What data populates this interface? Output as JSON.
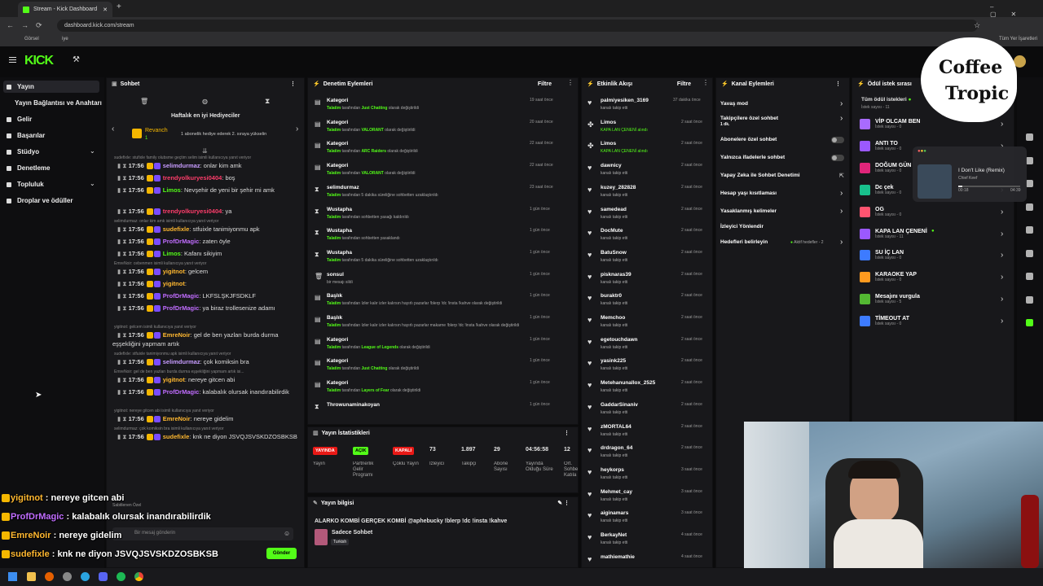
{
  "browser": {
    "tab_title": "Stream - Kick Dashboard",
    "url": "dashboard.kick.com/stream",
    "bookmarks": [
      "Görsel",
      "iye"
    ],
    "bookmarks_right": "Tüm Yer İşaretleri"
  },
  "nav": {
    "items": [
      "Yayın",
      "Yayın Bağlantısı ve Anahtarı",
      "Gelir",
      "Başarılar",
      "Stüdyo",
      "Denetleme",
      "Topluluk",
      "Droplar ve ödüller"
    ]
  },
  "chat": {
    "title": "Sohbet",
    "weekly": "Haftalık en iyi Hediyeciler",
    "top_name": "Revanch",
    "top_count": "1",
    "top_text": "1 abonelik hediye ederek 2. sıraya yükselin",
    "lines": [
      {
        "reply": "sudefixle: stufixle family olubsme geçtim selim isimli kullanıcıya yanıt veriyor",
        "user": "selimdurmaz",
        "color": "#c79cff",
        "text": "onlar kim amk",
        "time": "17:56"
      },
      {
        "user": "trendyolkuryesi0404",
        "color": "#ff3d6b",
        "text": "boş",
        "time": "17:56"
      },
      {
        "user": "Limos",
        "color": "#53fc18",
        "text": "Nevşehir de yeni bir şehir mi amk",
        "time": "17:56"
      },
      {
        "user": "trendyolkuryesi0404",
        "color": "#ff3d6b",
        "text": "ya",
        "time": "17:56"
      },
      {
        "reply": "selimdurmaz: onlar kim amk isimli kullanıcıya yanıt veriyor",
        "user": "sudefixle",
        "color": "#ffb830",
        "text": "stfuixle tanimiyonmu apk",
        "time": "17:56"
      },
      {
        "user": "ProfDrMagic",
        "color": "#c16dff",
        "text": "zaten öyle",
        "time": "17:56"
      },
      {
        "user": "Limos",
        "color": "#53fc18",
        "text": "Kafanı sikiyim",
        "time": "17:56"
      },
      {
        "reply": "EmreNoir: cebenmen isimli kullanıcıya yanıt veriyor",
        "user": "yigitnot",
        "color": "#ffb830",
        "text": "gelcem",
        "time": "17:56"
      },
      {
        "user": "yigitnot",
        "color": "#ffb830",
        "text": "",
        "time": "17:56"
      },
      {
        "user": "ProfDrMagic",
        "color": "#c16dff",
        "text": "LKFSLŞKJFSDKLF",
        "time": "17:56"
      },
      {
        "user": "ProfDrMagic",
        "color": "#c16dff",
        "text": "ya biraz trollesenize adamı",
        "time": "17:56"
      },
      {
        "reply": "yigitnot: gelcem isimli kullanıcıya yanıt veriyor",
        "user": "EmreNoir",
        "color": "#ffb830",
        "text": "gel de ben yazları burda durma eşşekliğini yapmam artık",
        "time": "17:56"
      },
      {
        "reply": "sudefixle: stfuixle tanimiyonmu apk isimli kullanıcıya yanıt veriyor",
        "user": "selimdurmaz",
        "color": "#c79cff",
        "text": "çok komiksin bra",
        "time": "17:56"
      },
      {
        "reply": "EmreNoir: gel de ben yazları burda durma eşşekliğini yapmam artık isi...",
        "user": "yigitnot",
        "color": "#ffb830",
        "text": "nereye gitcen abi",
        "time": "17:56"
      },
      {
        "user": "ProfDrMagic",
        "color": "#c16dff",
        "text": "kalabalık olursak inandırabilirdik",
        "time": "17:56"
      },
      {
        "reply": "yigitnot: nereye gitcen abi isimli kullanıcıya yanıt veriyor",
        "user": "EmreNoir",
        "color": "#ffb830",
        "text": "nereye gidelim",
        "time": "17:56"
      },
      {
        "reply": "selimdurmaz: çok komiksin bra isimli kullanıcıya yanıt veriyor",
        "user": "sudefixle",
        "color": "#ffb830",
        "text": "knk ne diyon JSVQJSVSKDZOSBKSB",
        "time": "17:56"
      }
    ],
    "input_placeholder": "Bir mesaj gönderin",
    "send": "Gönder",
    "pinned": "Sabitlenen Özel"
  },
  "overlay": [
    {
      "user": "yigitnot",
      "color": "#ffb830",
      "text": "nereye gitcen abi"
    },
    {
      "user": "ProfDrMagic",
      "color": "#c16dff",
      "text": "kalabalık olursak inandırabilirdik"
    },
    {
      "user": "EmreNoir",
      "color": "#ffb830",
      "text": "nereye gidelim"
    },
    {
      "user": "sudefixle",
      "color": "#ffb830",
      "text": "knk ne diyon JSVQJSVSKDZOSBKSB"
    }
  ],
  "moderation": {
    "title": "Denetim Eylemleri",
    "filter": "Filtre",
    "items": [
      {
        "title": "Kategori",
        "actor": "Talatim",
        "mid": " tarafından ",
        "target": "Just Chatting",
        "tail": " olarak değiştirildi",
        "time": "19 saat önce"
      },
      {
        "title": "Kategori",
        "actor": "Talatim",
        "mid": " tarafından ",
        "target": "VALORANT",
        "tail": " olarak değiştirildi",
        "time": "20 saat önce"
      },
      {
        "title": "Kategori",
        "actor": "Talatim",
        "mid": " tarafından ",
        "target": "ARC Raiders",
        "tail": " olarak değiştirildi",
        "time": "22 saat önce"
      },
      {
        "title": "Kategori",
        "actor": "Talatim",
        "mid": " tarafından ",
        "target": "VALORANT",
        "tail": " olarak değiştirildi",
        "time": "22 saat önce"
      },
      {
        "title": "selimdurmaz",
        "actor": "Talatim",
        "mid": " tarafından 5 dakika süreliğine sohbetten uzaklaştırıldı",
        "target": "",
        "tail": "",
        "time": "23 saat önce"
      },
      {
        "title": "Wustapha",
        "actor": "Talatim",
        "mid": " tarafından sohbetten yasağı kaldırıldı",
        "target": "",
        "tail": "",
        "time": "1 gün önce"
      },
      {
        "title": "Wustapha",
        "actor": "Talatim",
        "mid": " tarafından sohbetten yasaklandı",
        "target": "",
        "tail": "",
        "time": "1 gün önce"
      },
      {
        "title": "Wustapha",
        "actor": "Talatim",
        "mid": " tarafından 5 dakika süreliğine sohbetten uzaklaştırıldı",
        "target": "",
        "tail": "",
        "time": "1 gün önce"
      },
      {
        "title": "sonsul",
        "actor": "",
        "mid": "bir mesajı sildi",
        "target": "",
        "tail": "",
        "time": "1 gün önce"
      },
      {
        "title": "Başlık",
        "actor": "Talatim",
        "mid": " tarafından ",
        "target": "",
        "tail": "İzler kalır izler kalırsın hayırlı pazarlar !blerp !dc !insta !kahve olarak değiştirildi",
        "time": "1 gün önce"
      },
      {
        "title": "Başlık",
        "actor": "Talatim",
        "mid": " tarafından ",
        "target": "",
        "tail": "İzler kalır izler kalırsın hayırlı pazarlar makarne !blerp !dc !insta !kahve olarak değiştirildi",
        "time": "1 gün önce"
      },
      {
        "title": "Kategori",
        "actor": "Talatim",
        "mid": " tarafından ",
        "target": "League of Legends",
        "tail": " olarak değiştirildi",
        "time": "1 gün önce"
      },
      {
        "title": "Kategori",
        "actor": "Talatim",
        "mid": " tarafından ",
        "target": "Just Chatting",
        "tail": " olarak değiştirildi",
        "time": "1 gün önce"
      },
      {
        "title": "Kategori",
        "actor": "Talatim",
        "mid": " tarafından ",
        "target": "Layers of Fear",
        "tail": " olarak değiştirildi",
        "time": "1 gün önce"
      },
      {
        "title": "Throwunaminakoyan",
        "actor": "",
        "mid": "",
        "target": "",
        "tail": "",
        "time": "1 gün önce"
      }
    ]
  },
  "stats": {
    "title": "Yayın İstatistikleri",
    "cols": [
      {
        "value": "YAYINDA",
        "label": "Yayın",
        "color": "#e91916"
      },
      {
        "value": "AÇIK",
        "label": "Partnerlik Gelir Programı",
        "color": "#53fc18"
      },
      {
        "value": "KAPALI",
        "label": "Çoklu Yayın",
        "color": "#e91916"
      },
      {
        "value": "73",
        "label": "İzleyici"
      },
      {
        "value": "1.897",
        "label": "Takipçi"
      },
      {
        "value": "29",
        "label": "Abone Sayısı"
      },
      {
        "value": "04:56:58",
        "label": "Yayında Olduğu Süre"
      },
      {
        "value": "12",
        "label": "Ort. Sohbe Katıla"
      }
    ]
  },
  "info": {
    "title": "Yayın bilgisi",
    "stream_title": "ALARKO KOMBİ GERÇEK KOMBİ @aphebucky !blerp !dc !insta !kahve",
    "category": "Sadece Sohbet",
    "lang": "Turkish"
  },
  "activity": {
    "title": "Etkinlik Akışı",
    "filter": "Filtre",
    "items": [
      {
        "user": "palmiyesiken_3169",
        "sub": "kanalı takip etti",
        "time": "37 dakika önce",
        "kind": "follow"
      },
      {
        "user": "Limos",
        "sub": "KAPA LAN ÇENENİ alındı",
        "time": "2 saat önce",
        "kind": "reward"
      },
      {
        "user": "Limos",
        "sub": "KAPA LAN ÇENENİ alındı",
        "time": "2 saat önce",
        "kind": "reward"
      },
      {
        "user": "dawnicy",
        "sub": "kanalı takip etti",
        "time": "2 saat önce",
        "kind": "follow"
      },
      {
        "user": "kuzey_282828",
        "sub": "kanalı takip etti",
        "time": "2 saat önce",
        "kind": "follow"
      },
      {
        "user": "samedead",
        "sub": "kanalı takip etti",
        "time": "2 saat önce",
        "kind": "follow"
      },
      {
        "user": "DocMute",
        "sub": "kanalı takip etti",
        "time": "2 saat önce",
        "kind": "follow"
      },
      {
        "user": "BatuSnow",
        "sub": "kanalı takip etti",
        "time": "2 saat önce",
        "kind": "follow"
      },
      {
        "user": "pisknaras39",
        "sub": "kanalı takip etti",
        "time": "2 saat önce",
        "kind": "follow"
      },
      {
        "user": "buraktr0",
        "sub": "kanalı takip etti",
        "time": "2 saat önce",
        "kind": "follow"
      },
      {
        "user": "Memchoo",
        "sub": "kanalı takip etti",
        "time": "2 saat önce",
        "kind": "follow"
      },
      {
        "user": "egetouchdawn",
        "sub": "kanalı takip etti",
        "time": "2 saat önce",
        "kind": "follow"
      },
      {
        "user": "yasink225",
        "sub": "kanalı takip etti",
        "time": "2 saat önce",
        "kind": "follow"
      },
      {
        "user": "Metehanunallox_2525",
        "sub": "kanalı takip etti",
        "time": "2 saat önce",
        "kind": "follow"
      },
      {
        "user": "GaddarSinaniv",
        "sub": "kanalı takip etti",
        "time": "2 saat önce",
        "kind": "follow"
      },
      {
        "user": "zMORTAL64",
        "sub": "kanalı takip etti",
        "time": "2 saat önce",
        "kind": "follow"
      },
      {
        "user": "drdragon_64",
        "sub": "kanalı takip etti",
        "time": "2 saat önce",
        "kind": "follow"
      },
      {
        "user": "heykorps",
        "sub": "kanalı takip etti",
        "time": "3 saat önce",
        "kind": "follow"
      },
      {
        "user": "Mehmet_cay",
        "sub": "kanalı takip etti",
        "time": "3 saat önce",
        "kind": "follow"
      },
      {
        "user": "aiginamars",
        "sub": "kanalı takip etti",
        "time": "3 saat önce",
        "kind": "follow"
      },
      {
        "user": "BerkayNet",
        "sub": "kanalı takip etti",
        "time": "4 saat önce",
        "kind": "follow"
      },
      {
        "user": "mathiemathie",
        "sub": "",
        "time": "4 saat önce",
        "kind": "follow"
      }
    ]
  },
  "channel": {
    "title": "Kanal Eylemleri",
    "items": [
      {
        "label": "Yavaş mod",
        "sub": "",
        "ctl": "chev"
      },
      {
        "label": "Takipçilere özel sohbet",
        "sub": "1 dk.",
        "ctl": "chev"
      },
      {
        "label": "Abonelere özel sohbet",
        "sub": "",
        "ctl": "toggle"
      },
      {
        "label": "Yalnızca ifadelerle sohbet",
        "sub": "",
        "ctl": "toggle"
      },
      {
        "label": "Yapay Zeka ile Sohbet Denetimi",
        "sub": "",
        "ctl": "ext"
      },
      {
        "label": "Hesap yaşı kısıtlaması",
        "sub": "",
        "ctl": "chev"
      },
      {
        "label": "Yasaklanmış kelimeler",
        "sub": "",
        "ctl": "chev"
      },
      {
        "label": "İzleyici Yönlendir",
        "sub": "",
        "ctl": "none"
      },
      {
        "label": "Hedefleri belirleyin",
        "sub": "",
        "ctl": "goal"
      }
    ],
    "goal_text": "Aktif hedefler - 2"
  },
  "rewards": {
    "title": "Ödül istek sırası",
    "all": "Tüm ödül istekleri",
    "all_sub": "İstek sayısı - 11",
    "items": [
      {
        "name": "VİP OLCAM BEN",
        "sub": "İstek sayısı - 0",
        "color": "#a86bff",
        "active": false
      },
      {
        "name": "ANTI TO",
        "sub": "İstek sayısı - 0",
        "color": "#9b59ff",
        "active": false
      },
      {
        "name": "DOĞUM GÜN",
        "sub": "İstek sayısı - 0",
        "color": "#e0257a",
        "active": false
      },
      {
        "name": "Dc çek",
        "sub": "İstek sayısı - 0",
        "color": "#18c08c",
        "active": false
      },
      {
        "name": "OG",
        "sub": "İstek sayısı - 0",
        "color": "#ff5470",
        "active": false
      },
      {
        "name": "KAPA LAN ÇENENİ",
        "sub": "İstek sayısı - 11",
        "color": "#9b59ff",
        "active": true
      },
      {
        "name": "SU İÇ LAN",
        "sub": "İstek sayısı - 0",
        "color": "#3d7bff",
        "active": false
      },
      {
        "name": "KARAOKE YAP",
        "sub": "İstek sayısı - 0",
        "color": "#ff9a1f",
        "active": false
      },
      {
        "name": "Mesajını vurgula",
        "sub": "İstek sayısı - 5",
        "color": "#53b832",
        "active": false
      },
      {
        "name": "TİMEOUT AT",
        "sub": "İstek sayısı - 0",
        "color": "#3d7bff",
        "active": false
      }
    ]
  },
  "music": {
    "song": "I Don't Like (Remix)",
    "artist": "Chief Keef",
    "pos": "00:18",
    "dur": "04:39",
    "progress": 0.06
  },
  "brand": {
    "line1": "Coffee",
    "line2": "Tropic"
  }
}
